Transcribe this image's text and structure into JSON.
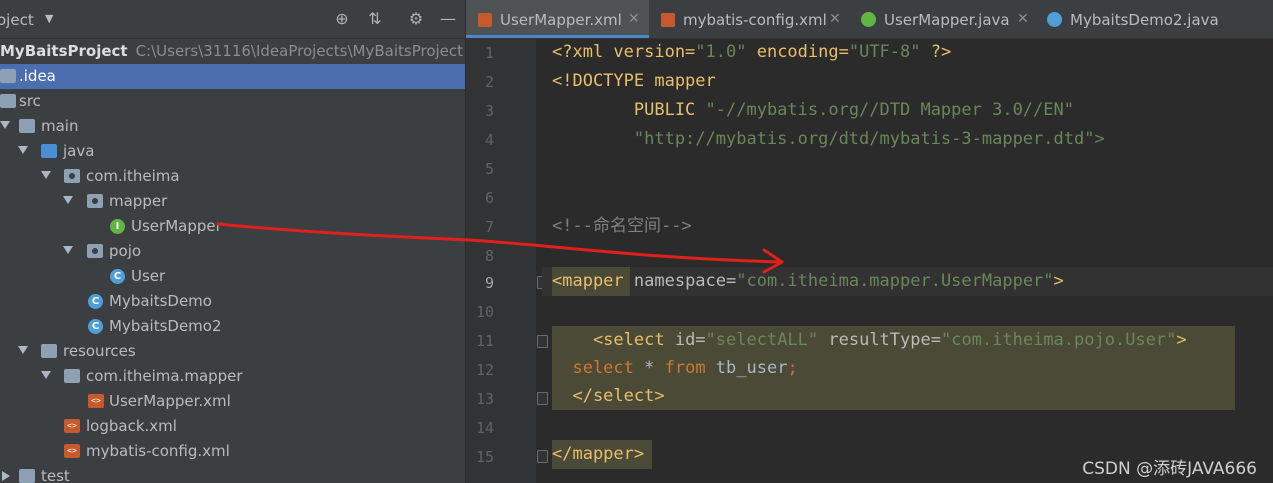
{
  "project_panel": {
    "title": "oject",
    "tree": [
      {
        "label": "MyBaitsProject",
        "path": "C:\\Users\\31116\\IdeaProjects\\MyBaitsProject"
      },
      {
        "label": ".idea"
      },
      {
        "label": "src"
      },
      {
        "label": "main"
      },
      {
        "label": "java"
      },
      {
        "label": "com.itheima"
      },
      {
        "label": "mapper"
      },
      {
        "label": "UserMapper"
      },
      {
        "label": "pojo"
      },
      {
        "label": "User"
      },
      {
        "label": "MybaitsDemo"
      },
      {
        "label": "MybaitsDemo2"
      },
      {
        "label": "resources"
      },
      {
        "label": "com.itheima.mapper"
      },
      {
        "label": "UserMapper.xml"
      },
      {
        "label": "logback.xml"
      },
      {
        "label": "mybatis-config.xml"
      },
      {
        "label": "test"
      }
    ]
  },
  "tabs": [
    {
      "label": "UserMapper.xml",
      "active": true
    },
    {
      "label": "mybatis-config.xml"
    },
    {
      "label": "UserMapper.java"
    },
    {
      "label": "MybaitsDemo2.java"
    }
  ],
  "line_numbers": [
    "1",
    "2",
    "3",
    "4",
    "5",
    "6",
    "7",
    "8",
    "9",
    "10",
    "11",
    "12",
    "13",
    "14",
    "15"
  ],
  "code": {
    "l1_a": "<?xml version=",
    "l1_b": "\"1.0\"",
    "l1_c": " encoding=",
    "l1_d": "\"UTF-8\"",
    "l1_e": " ?>",
    "l2": "<!DOCTYPE mapper",
    "l3_a": "        PUBLIC ",
    "l3_b": "\"-//mybatis.org//DTD Mapper 3.0//EN\"",
    "l4": "        \"http://mybatis.org/dtd/mybatis-3-mapper.dtd\">",
    "l7": "<!--命名空间-->",
    "l9_a": "<mapper",
    "l9_b": " namespace=",
    "l9_c": "\"com.itheima.mapper.UserMapper\"",
    "l9_d": ">",
    "l11_a": "    <select",
    "l11_b": " id=",
    "l11_c": "\"selectALL\"",
    "l11_d": " resultType=",
    "l11_e": "\"com.itheima.pojo.User\"",
    "l11_f": ">",
    "l12_a": "  select",
    "l12_b": " * ",
    "l12_c": "from",
    "l12_d": " tb_user",
    "l12_e": ";",
    "l13": "  </select>",
    "l15": "</mapper>"
  },
  "watermark": "CSDN @添砖JAVA666",
  "colors": {
    "panel_bg": "#3c3f41",
    "editor_bg": "#2b2b2b",
    "selection": "#4b6eaf",
    "tag": "#e8bf6a",
    "string": "#6a8759",
    "keyword": "#cc7832",
    "arrow": "#e0201b"
  }
}
